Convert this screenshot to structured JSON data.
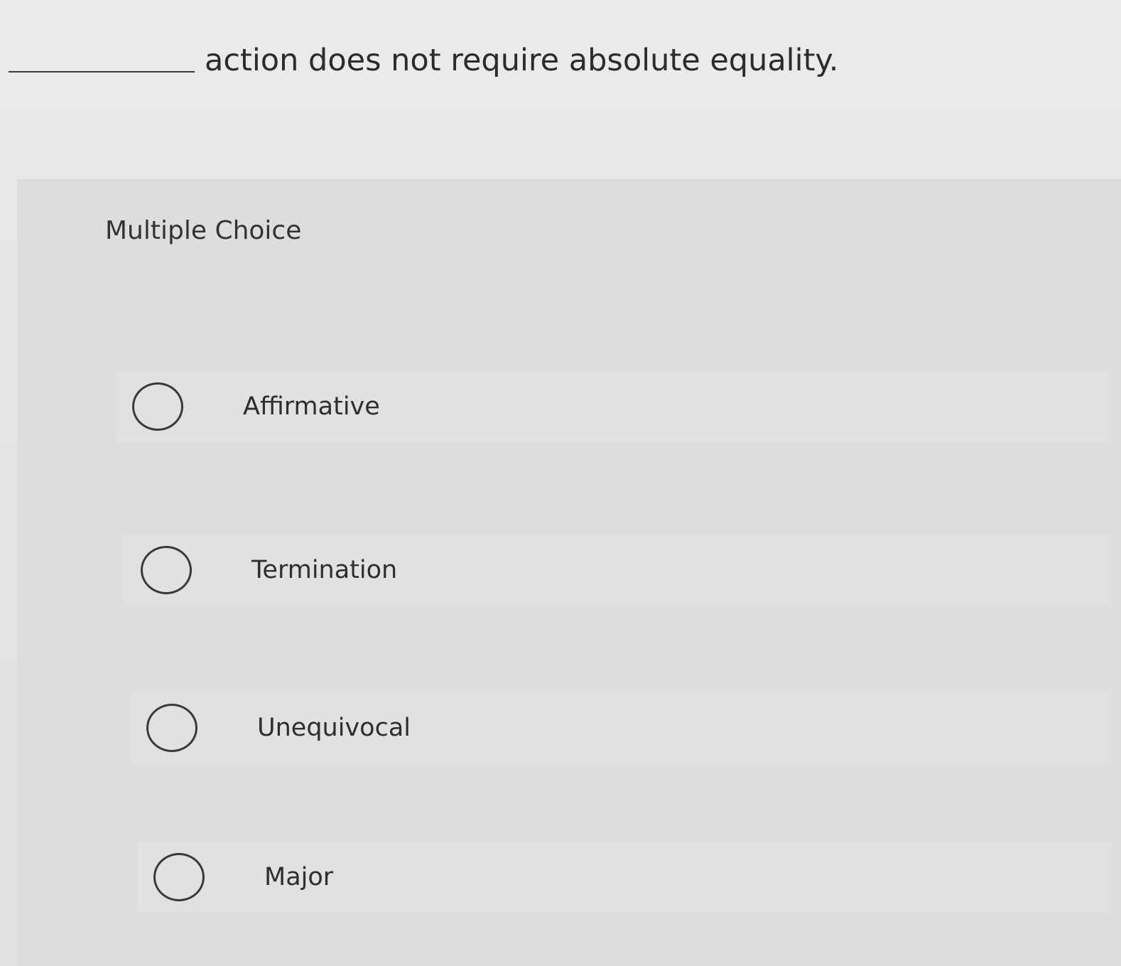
{
  "question": {
    "text": "action does not require absolute equality."
  },
  "multiple_choice": {
    "title": "Multiple Choice",
    "options": [
      {
        "label": "Affirmative",
        "selected": false
      },
      {
        "label": "Termination",
        "selected": false
      },
      {
        "label": "Unequivocal",
        "selected": false
      },
      {
        "label": "Major",
        "selected": false
      }
    ]
  }
}
